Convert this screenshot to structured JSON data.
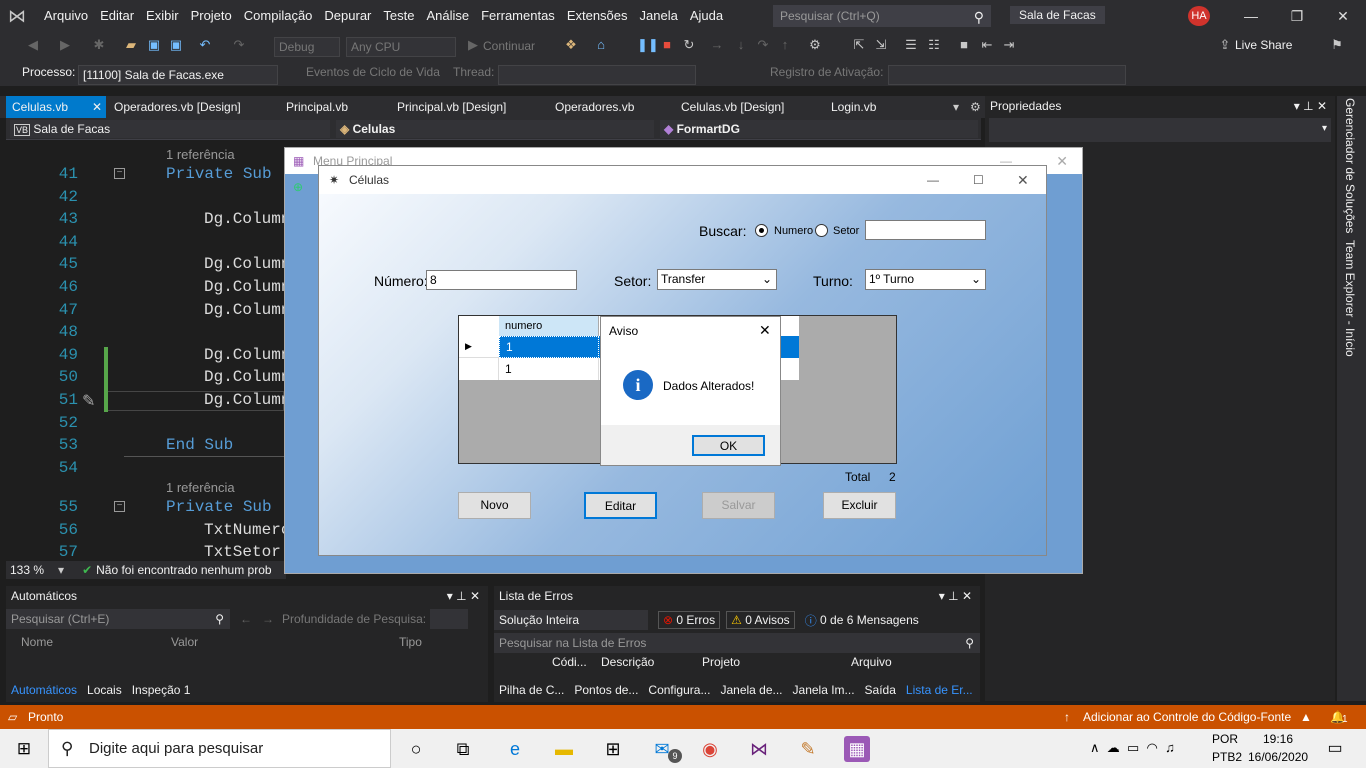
{
  "vs": {
    "menu": [
      "Arquivo",
      "Editar",
      "Exibir",
      "Projeto",
      "Compilação",
      "Depurar",
      "Teste",
      "Análise",
      "Ferramentas",
      "Extensões",
      "Janela",
      "Ajuda"
    ],
    "search_placeholder": "Pesquisar (Ctrl+Q)",
    "solution_name": "Sala de Facas",
    "avatar": "HA",
    "toolbar": {
      "config": "Debug",
      "platform": "Any CPU",
      "continue": "Continuar",
      "live_share": "Live Share"
    },
    "process": {
      "label": "Processo:",
      "value": "[11100] Sala de Facas.exe",
      "lifecycle": "Eventos de Ciclo de Vida",
      "thread": "Thread:",
      "activation": "Registro de Ativação:"
    },
    "tabs": [
      "Celulas.vb",
      "Operadores.vb [Design]",
      "Principal.vb",
      "Principal.vb [Design]",
      "Operadores.vb",
      "Celulas.vb [Design]",
      "Login.vb"
    ],
    "nav": {
      "project": "Sala de Facas",
      "class": "Celulas",
      "method": "FormartDG"
    },
    "code": {
      "lines": [
        "41",
        "42",
        "43",
        "44",
        "45",
        "46",
        "47",
        "48",
        "49",
        "50",
        "51",
        "52",
        "53",
        "54",
        "55",
        "56",
        "57"
      ],
      "ref1": "1 referência",
      "ref2": "1 referência",
      "l41a": "Private Sub",
      "l43": "Dg.Column",
      "l45": "Dg.Column",
      "l46": "Dg.Column",
      "l47": "Dg.Column",
      "l49": "Dg.Column",
      "l50": "Dg.Column",
      "l51": "Dg.Column",
      "l53": "End Sub",
      "l55": "Private Sub",
      "l56": "TxtNumero",
      "l57": "TxtSetor"
    },
    "zoom": "133 %",
    "issues": "Não foi encontrado nenhum prob",
    "properties_title": "Propriedades",
    "side": [
      "Gerenciador de Soluções",
      "Team Explorer - Início"
    ],
    "autos": {
      "title": "Automáticos",
      "search": "Pesquisar (Ctrl+E)",
      "depth": "Profundidade de Pesquisa:",
      "cols": [
        "Nome",
        "Valor",
        "Tipo"
      ],
      "tabs": [
        "Automáticos",
        "Locais",
        "Inspeção 1"
      ]
    },
    "errors": {
      "title": "Lista de Erros",
      "scope": "Solução Inteira",
      "errors": "0 Erros",
      "warnings": "0 Avisos",
      "messages": "0 de 6 Mensagens",
      "search": "Pesquisar na Lista de Erros",
      "cols": [
        "Códi...",
        "Descrição",
        "Projeto",
        "Arquivo"
      ],
      "tabs": [
        "Pilha de C...",
        "Pontos de...",
        "Configura...",
        "Janela de...",
        "Janela Im...",
        "Saída",
        "Lista de Er..."
      ]
    },
    "status": {
      "ready": "Pronto",
      "source_control": "Adicionar ao Controle do Código-Fonte",
      "notif": "1"
    }
  },
  "menu_window": {
    "title": "Menu Principal"
  },
  "cell_window": {
    "title": "Células",
    "search_label": "Buscar:",
    "radio_numero": "Numero",
    "radio_setor": "Setor",
    "numero_label": "Número:",
    "numero_value": "8",
    "setor_label": "Setor:",
    "setor_value": "Transfer",
    "turno_label": "Turno:",
    "turno_value": "1º Turno",
    "grid": {
      "header": "numero",
      "rows": [
        "1",
        "1"
      ]
    },
    "total_label": "Total",
    "total_value": "2",
    "buttons": {
      "novo": "Novo",
      "editar": "Editar",
      "salvar": "Salvar",
      "excluir": "Excluir"
    }
  },
  "dialog": {
    "title": "Aviso",
    "message": "Dados Alterados!",
    "ok": "OK"
  },
  "taskbar": {
    "search": "Digite aqui para pesquisar",
    "lang1": "POR",
    "lang2": "PTB2",
    "time": "19:16",
    "date": "16/06/2020",
    "mail_count": "9"
  }
}
